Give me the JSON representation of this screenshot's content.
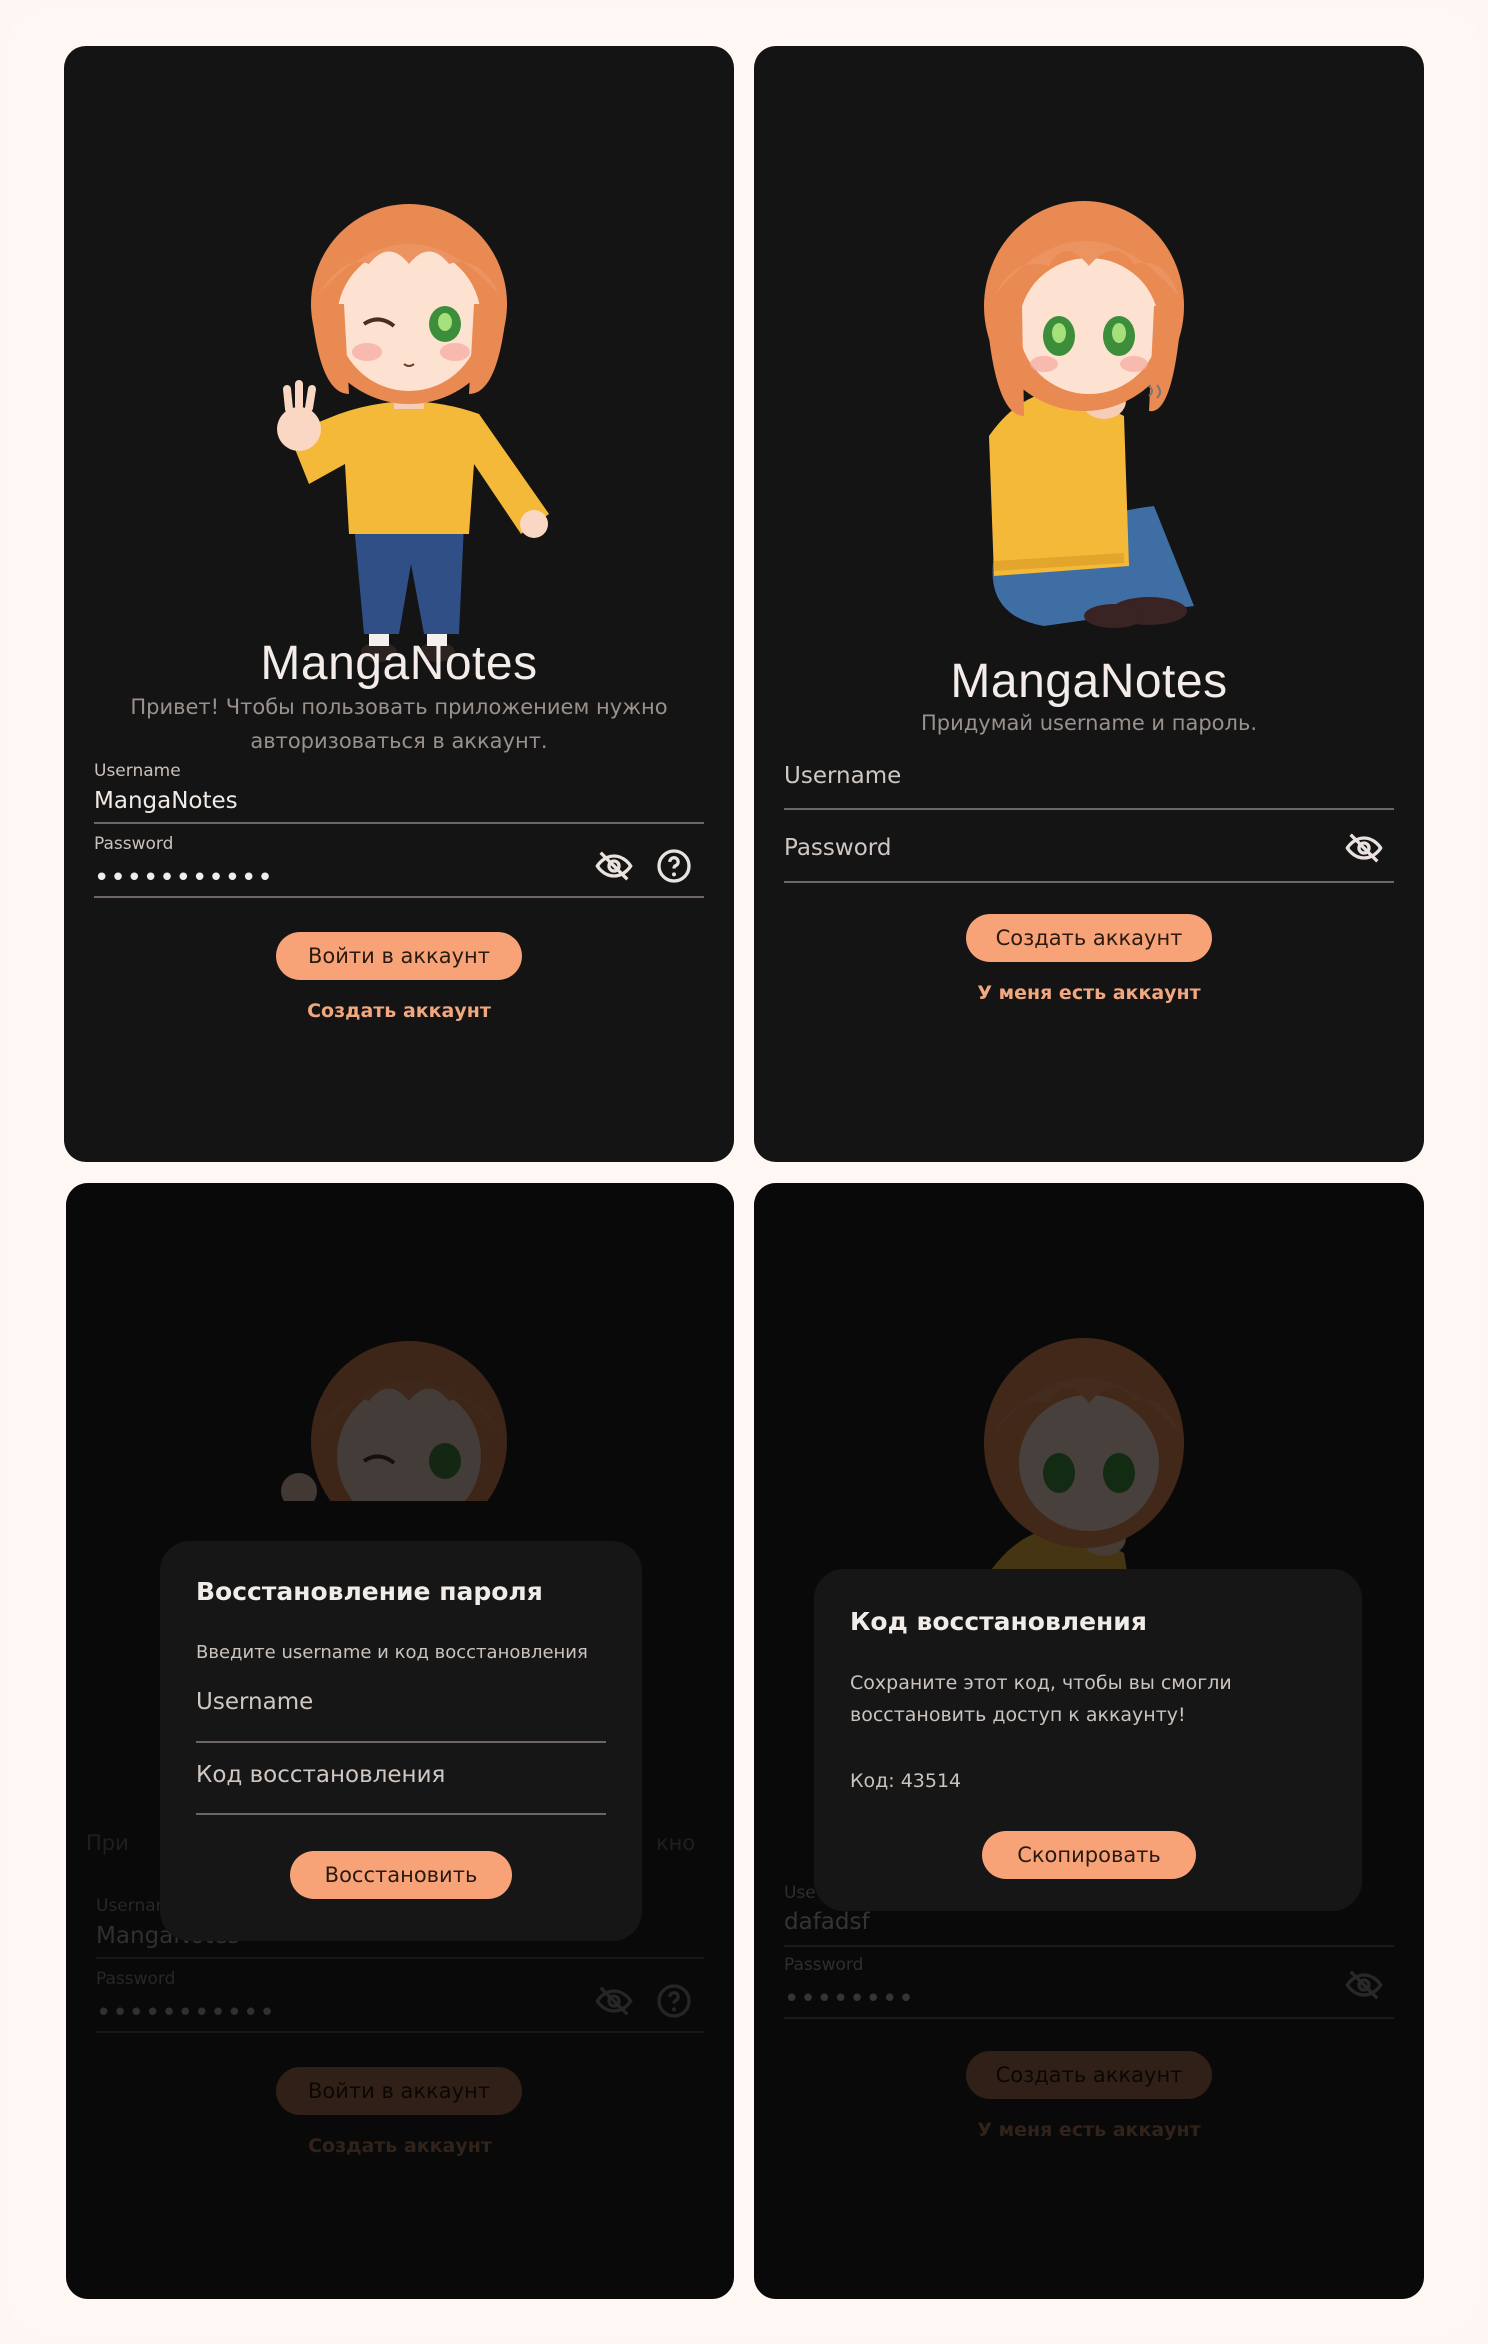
{
  "app_name": "MangaNotes",
  "colors": {
    "accent": "#f7a377",
    "background": "#141414",
    "frame": "#fff7f4",
    "text": "#f3ece8"
  },
  "login": {
    "greeting": "Привет! Чтобы пользовать приложением нужно авторизоваться в аккаунт.",
    "username_label": "Username",
    "username_value": "MangaNotes",
    "password_label": "Password",
    "password_mask": "•••••••••••",
    "login_button": "Войти в аккаунт",
    "create_link": "Создать аккаунт"
  },
  "register": {
    "subtitle": "Придумай username и пароль.",
    "username_placeholder": "Username",
    "password_placeholder": "Password",
    "create_button": "Создать аккаунт",
    "have_account_link": "У меня есть аккаунт"
  },
  "recovery_dialog": {
    "title": "Восстановление пароля",
    "description": "Введите username и код восстановления",
    "username_placeholder": "Username",
    "code_placeholder": "Код восстановления",
    "restore_button": "Восстановить",
    "greeting_left_fragment": "При",
    "greeting_right_fragment": "кно",
    "username_label_fragment": "Usernan"
  },
  "code_dialog": {
    "title": "Код восстановления",
    "description": "Сохраните этот код, чтобы вы смогли восстановить доступ к аккаунту!",
    "code_label": "Код: 43514",
    "copy_button": "Скопировать",
    "username_label_fragment": "Use",
    "username_value": "dafadsf",
    "password_label": "Password",
    "password_mask": "••••••••"
  },
  "icons": [
    "eye-off-icon",
    "help-circle-icon"
  ]
}
